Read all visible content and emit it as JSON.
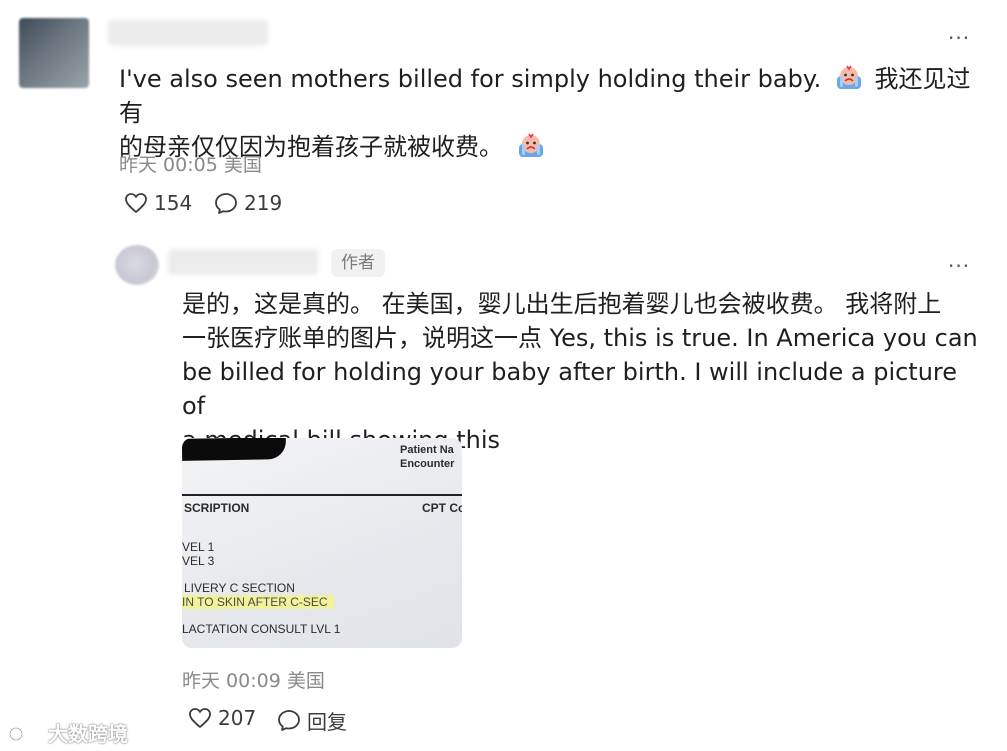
{
  "comment1": {
    "text_en": "I've also seen mothers billed for simply holding their baby.",
    "text_zh_line1": "我还见过有",
    "text_zh_line2": "的母亲仅仅因为抱着孩子就被收费。",
    "emoji": "crying-face-emoji",
    "time": "昨天 00:05",
    "location": "美国",
    "likes": "154",
    "replies": "219",
    "more": "···"
  },
  "reply": {
    "author_badge": "作者",
    "more": "···",
    "text_lines": [
      "是的，这是真的。 在美国，婴儿出生后抱着婴儿也会被收费。 我将附上",
      "一张医疗账单的图片，说明这一点 Yes, this is true. In America you can",
      "be billed for holding your baby after birth. I will include a picture of",
      "a medical bill showing this"
    ],
    "image": {
      "header_right_1": "Patient Na",
      "header_right_2": "Encounter",
      "col_description": "SCRIPTION",
      "col_cpt": "CPT Co",
      "row1": "VEL 1",
      "row2": "VEL 3",
      "row3": "LIVERY C SECTION",
      "row4": "IN TO SKIN AFTER C-SEC",
      "row5": "LACTATION CONSULT LVL 1"
    },
    "time": "昨天 00:09",
    "location": "美国",
    "likes": "207",
    "reply_label": "回复"
  },
  "watermark": {
    "text": "大数跨境",
    "icon": "brand-logo-icon"
  },
  "colors": {
    "text": "#1f1f1f",
    "meta": "#8a8a8a",
    "badge_bg": "#f1f1f1",
    "highlight": "#f2f29c"
  }
}
